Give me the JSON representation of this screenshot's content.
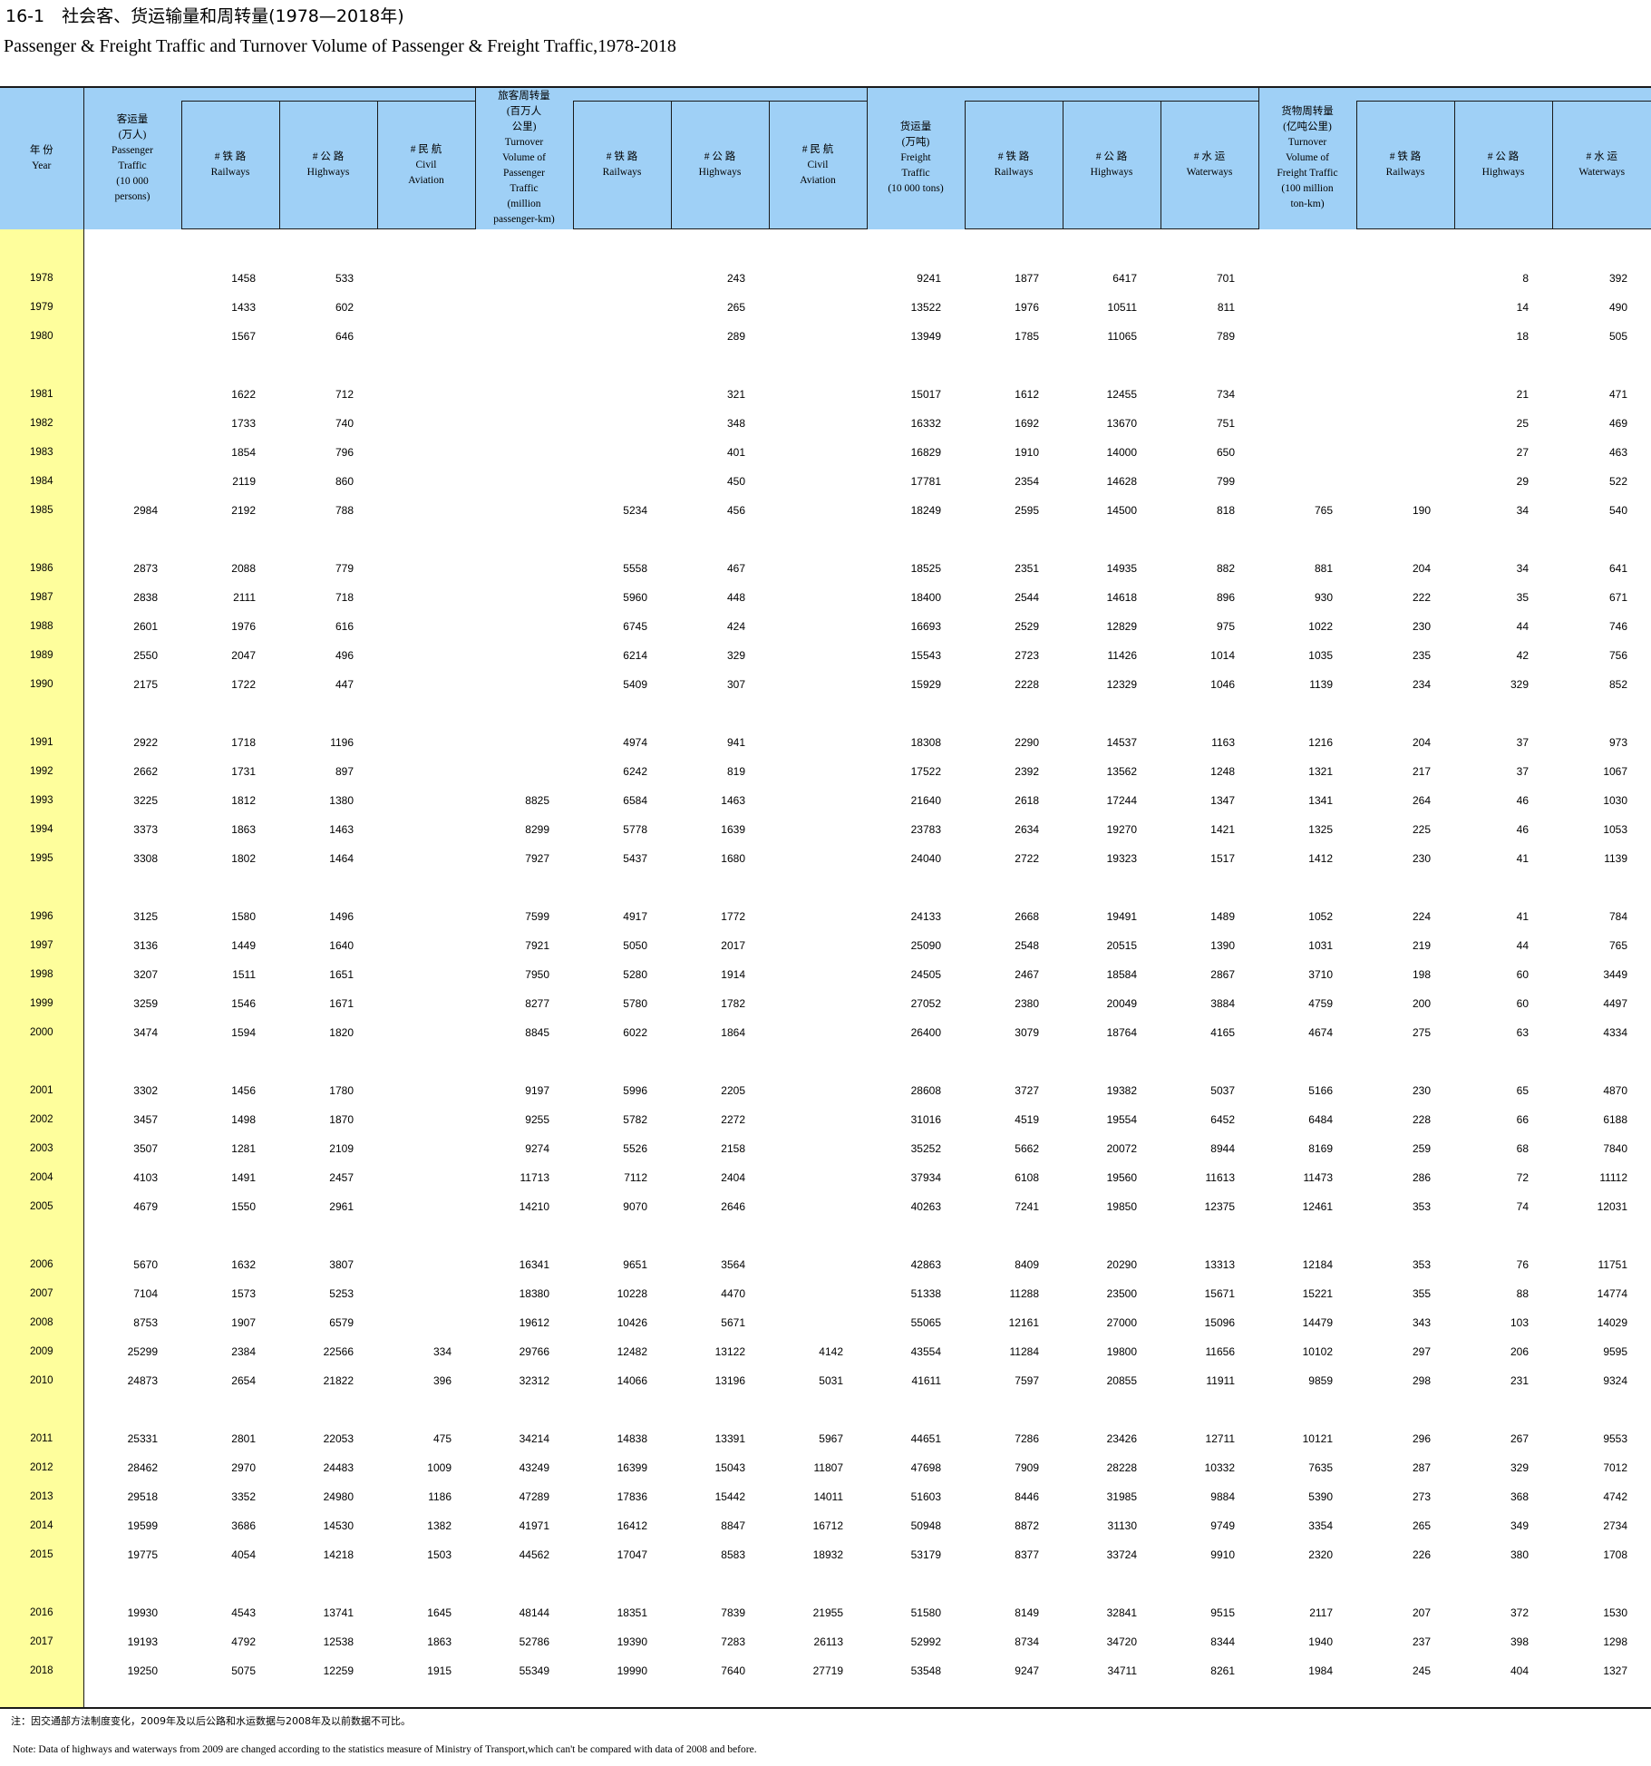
{
  "title": {
    "cn": "16-1　社会客、货运输量和周转量(1978—2018年)",
    "en": "Passenger & Freight Traffic and Turnover Volume of Passenger & Freight Traffic,1978-2018"
  },
  "headers": {
    "year": [
      "年 份",
      "Year"
    ],
    "passenger_traffic": [
      "客运量",
      "(万人)",
      "Passenger",
      "Traffic",
      "(10 000",
      "persons)"
    ],
    "p_railways": [
      "# 铁 路",
      "Railways"
    ],
    "p_highways": [
      "# 公 路",
      "Highways"
    ],
    "p_civil": [
      "# 民 航",
      "Civil",
      "Aviation"
    ],
    "passenger_turnover": [
      "旅客周转量",
      "(百万人",
      "公里)",
      "Turnover",
      "Volume of",
      "Passenger",
      "Traffic",
      "(million",
      "passenger-km)"
    ],
    "pt_railways": [
      "# 铁 路",
      "Railways"
    ],
    "pt_highways": [
      "# 公 路",
      "Highways"
    ],
    "pt_civil": [
      "# 民 航",
      "Civil",
      "Aviation"
    ],
    "freight_traffic": [
      "货运量",
      "(万吨)",
      "Freight",
      "Traffic",
      "(10 000 tons)"
    ],
    "f_railways": [
      "# 铁 路",
      "Railways"
    ],
    "f_highways": [
      "# 公 路",
      "Highways"
    ],
    "f_waterways": [
      "# 水 运",
      "Waterways"
    ],
    "freight_turnover": [
      "货物周转量",
      "(亿吨公里)",
      "Turnover",
      "Volume of",
      "Freight Traffic",
      "(100 million",
      "ton-km)"
    ],
    "ft_railways": [
      "# 铁 路",
      "Railways"
    ],
    "ft_highways": [
      "# 公 路",
      "Highways"
    ],
    "ft_waterways": [
      "# 水 运",
      "Waterways"
    ]
  },
  "groups": [
    [
      [
        "1978",
        "",
        "1458",
        "533",
        "",
        "",
        "",
        "243",
        "",
        "9241",
        "1877",
        "6417",
        "701",
        "",
        "",
        "8",
        "392"
      ],
      [
        "1979",
        "",
        "1433",
        "602",
        "",
        "",
        "",
        "265",
        "",
        "13522",
        "1976",
        "10511",
        "811",
        "",
        "",
        "14",
        "490"
      ],
      [
        "1980",
        "",
        "1567",
        "646",
        "",
        "",
        "",
        "289",
        "",
        "13949",
        "1785",
        "11065",
        "789",
        "",
        "",
        "18",
        "505"
      ]
    ],
    [
      [
        "1981",
        "",
        "1622",
        "712",
        "",
        "",
        "",
        "321",
        "",
        "15017",
        "1612",
        "12455",
        "734",
        "",
        "",
        "21",
        "471"
      ],
      [
        "1982",
        "",
        "1733",
        "740",
        "",
        "",
        "",
        "348",
        "",
        "16332",
        "1692",
        "13670",
        "751",
        "",
        "",
        "25",
        "469"
      ],
      [
        "1983",
        "",
        "1854",
        "796",
        "",
        "",
        "",
        "401",
        "",
        "16829",
        "1910",
        "14000",
        "650",
        "",
        "",
        "27",
        "463"
      ],
      [
        "1984",
        "",
        "2119",
        "860",
        "",
        "",
        "",
        "450",
        "",
        "17781",
        "2354",
        "14628",
        "799",
        "",
        "",
        "29",
        "522"
      ],
      [
        "1985",
        "2984",
        "2192",
        "788",
        "",
        "",
        "5234",
        "456",
        "",
        "18249",
        "2595",
        "14500",
        "818",
        "765",
        "190",
        "34",
        "540"
      ]
    ],
    [
      [
        "1986",
        "2873",
        "2088",
        "779",
        "",
        "",
        "5558",
        "467",
        "",
        "18525",
        "2351",
        "14935",
        "882",
        "881",
        "204",
        "34",
        "641"
      ],
      [
        "1987",
        "2838",
        "2111",
        "718",
        "",
        "",
        "5960",
        "448",
        "",
        "18400",
        "2544",
        "14618",
        "896",
        "930",
        "222",
        "35",
        "671"
      ],
      [
        "1988",
        "2601",
        "1976",
        "616",
        "",
        "",
        "6745",
        "424",
        "",
        "16693",
        "2529",
        "12829",
        "975",
        "1022",
        "230",
        "44",
        "746"
      ],
      [
        "1989",
        "2550",
        "2047",
        "496",
        "",
        "",
        "6214",
        "329",
        "",
        "15543",
        "2723",
        "11426",
        "1014",
        "1035",
        "235",
        "42",
        "756"
      ],
      [
        "1990",
        "2175",
        "1722",
        "447",
        "",
        "",
        "5409",
        "307",
        "",
        "15929",
        "2228",
        "12329",
        "1046",
        "1139",
        "234",
        "329",
        "852"
      ]
    ],
    [
      [
        "1991",
        "2922",
        "1718",
        "1196",
        "",
        "",
        "4974",
        "941",
        "",
        "18308",
        "2290",
        "14537",
        "1163",
        "1216",
        "204",
        "37",
        "973"
      ],
      [
        "1992",
        "2662",
        "1731",
        "897",
        "",
        "",
        "6242",
        "819",
        "",
        "17522",
        "2392",
        "13562",
        "1248",
        "1321",
        "217",
        "37",
        "1067"
      ],
      [
        "1993",
        "3225",
        "1812",
        "1380",
        "",
        "8825",
        "6584",
        "1463",
        "",
        "21640",
        "2618",
        "17244",
        "1347",
        "1341",
        "264",
        "46",
        "1030"
      ],
      [
        "1994",
        "3373",
        "1863",
        "1463",
        "",
        "8299",
        "5778",
        "1639",
        "",
        "23783",
        "2634",
        "19270",
        "1421",
        "1325",
        "225",
        "46",
        "1053"
      ],
      [
        "1995",
        "3308",
        "1802",
        "1464",
        "",
        "7927",
        "5437",
        "1680",
        "",
        "24040",
        "2722",
        "19323",
        "1517",
        "1412",
        "230",
        "41",
        "1139"
      ]
    ],
    [
      [
        "1996",
        "3125",
        "1580",
        "1496",
        "",
        "7599",
        "4917",
        "1772",
        "",
        "24133",
        "2668",
        "19491",
        "1489",
        "1052",
        "224",
        "41",
        "784"
      ],
      [
        "1997",
        "3136",
        "1449",
        "1640",
        "",
        "7921",
        "5050",
        "2017",
        "",
        "25090",
        "2548",
        "20515",
        "1390",
        "1031",
        "219",
        "44",
        "765"
      ],
      [
        "1998",
        "3207",
        "1511",
        "1651",
        "",
        "7950",
        "5280",
        "1914",
        "",
        "24505",
        "2467",
        "18584",
        "2867",
        "3710",
        "198",
        "60",
        "3449"
      ],
      [
        "1999",
        "3259",
        "1546",
        "1671",
        "",
        "8277",
        "5780",
        "1782",
        "",
        "27052",
        "2380",
        "20049",
        "3884",
        "4759",
        "200",
        "60",
        "4497"
      ],
      [
        "2000",
        "3474",
        "1594",
        "1820",
        "",
        "8845",
        "6022",
        "1864",
        "",
        "26400",
        "3079",
        "18764",
        "4165",
        "4674",
        "275",
        "63",
        "4334"
      ]
    ],
    [
      [
        "2001",
        "3302",
        "1456",
        "1780",
        "",
        "9197",
        "5996",
        "2205",
        "",
        "28608",
        "3727",
        "19382",
        "5037",
        "5166",
        "230",
        "65",
        "4870"
      ],
      [
        "2002",
        "3457",
        "1498",
        "1870",
        "",
        "9255",
        "5782",
        "2272",
        "",
        "31016",
        "4519",
        "19554",
        "6452",
        "6484",
        "228",
        "66",
        "6188"
      ],
      [
        "2003",
        "3507",
        "1281",
        "2109",
        "",
        "9274",
        "5526",
        "2158",
        "",
        "35252",
        "5662",
        "20072",
        "8944",
        "8169",
        "259",
        "68",
        "7840"
      ],
      [
        "2004",
        "4103",
        "1491",
        "2457",
        "",
        "11713",
        "7112",
        "2404",
        "",
        "37934",
        "6108",
        "19560",
        "11613",
        "11473",
        "286",
        "72",
        "11112"
      ],
      [
        "2005",
        "4679",
        "1550",
        "2961",
        "",
        "14210",
        "9070",
        "2646",
        "",
        "40263",
        "7241",
        "19850",
        "12375",
        "12461",
        "353",
        "74",
        "12031"
      ]
    ],
    [
      [
        "2006",
        "5670",
        "1632",
        "3807",
        "",
        "16341",
        "9651",
        "3564",
        "",
        "42863",
        "8409",
        "20290",
        "13313",
        "12184",
        "353",
        "76",
        "11751"
      ],
      [
        "2007",
        "7104",
        "1573",
        "5253",
        "",
        "18380",
        "10228",
        "4470",
        "",
        "51338",
        "11288",
        "23500",
        "15671",
        "15221",
        "355",
        "88",
        "14774"
      ],
      [
        "2008",
        "8753",
        "1907",
        "6579",
        "",
        "19612",
        "10426",
        "5671",
        "",
        "55065",
        "12161",
        "27000",
        "15096",
        "14479",
        "343",
        "103",
        "14029"
      ],
      [
        "2009",
        "25299",
        "2384",
        "22566",
        "334",
        "29766",
        "12482",
        "13122",
        "4142",
        "43554",
        "11284",
        "19800",
        "11656",
        "10102",
        "297",
        "206",
        "9595"
      ],
      [
        "2010",
        "24873",
        "2654",
        "21822",
        "396",
        "32312",
        "14066",
        "13196",
        "5031",
        "41611",
        "7597",
        "20855",
        "11911",
        "9859",
        "298",
        "231",
        "9324"
      ]
    ],
    [
      [
        "2011",
        "25331",
        "2801",
        "22053",
        "475",
        "34214",
        "14838",
        "13391",
        "5967",
        "44651",
        "7286",
        "23426",
        "12711",
        "10121",
        "296",
        "267",
        "9553"
      ],
      [
        "2012",
        "28462",
        "2970",
        "24483",
        "1009",
        "43249",
        "16399",
        "15043",
        "11807",
        "47698",
        "7909",
        "28228",
        "10332",
        "7635",
        "287",
        "329",
        "7012"
      ],
      [
        "2013",
        "29518",
        "3352",
        "24980",
        "1186",
        "47289",
        "17836",
        "15442",
        "14011",
        "51603",
        "8446",
        "31985",
        "9884",
        "5390",
        "273",
        "368",
        "4742"
      ],
      [
        "2014",
        "19599",
        "3686",
        "14530",
        "1382",
        "41971",
        "16412",
        "8847",
        "16712",
        "50948",
        "8872",
        "31130",
        "9749",
        "3354",
        "265",
        "349",
        "2734"
      ],
      [
        "2015",
        "19775",
        "4054",
        "14218",
        "1503",
        "44562",
        "17047",
        "8583",
        "18932",
        "53179",
        "8377",
        "33724",
        "9910",
        "2320",
        "226",
        "380",
        "1708"
      ]
    ],
    [
      [
        "2016",
        "19930",
        "4543",
        "13741",
        "1645",
        "48144",
        "18351",
        "7839",
        "21955",
        "51580",
        "8149",
        "32841",
        "9515",
        "2117",
        "207",
        "372",
        "1530"
      ],
      [
        "2017",
        "19193",
        "4792",
        "12538",
        "1863",
        "52786",
        "19390",
        "7283",
        "26113",
        "52992",
        "8734",
        "34720",
        "8344",
        "1940",
        "237",
        "398",
        "1298"
      ],
      [
        "2018",
        "19250",
        "5075",
        "12259",
        "1915",
        "55349",
        "19990",
        "7640",
        "27719",
        "53548",
        "9247",
        "34711",
        "8261",
        "1984",
        "245",
        "404",
        "1327"
      ]
    ]
  ],
  "notes": {
    "cn": "注：因交通部方法制度变化，2009年及以后公路和水运数据与2008年及以前数据不可比。",
    "en": "Note: Data of highways and waterways from 2009 are changed according to the statistics measure of Ministry of Transport,which can't be compared with data of 2008 and before."
  },
  "colors": {
    "header_bg": "#9fd0f6",
    "year_col_bg": "#fefe9c",
    "rules": "#1a1a1a"
  }
}
